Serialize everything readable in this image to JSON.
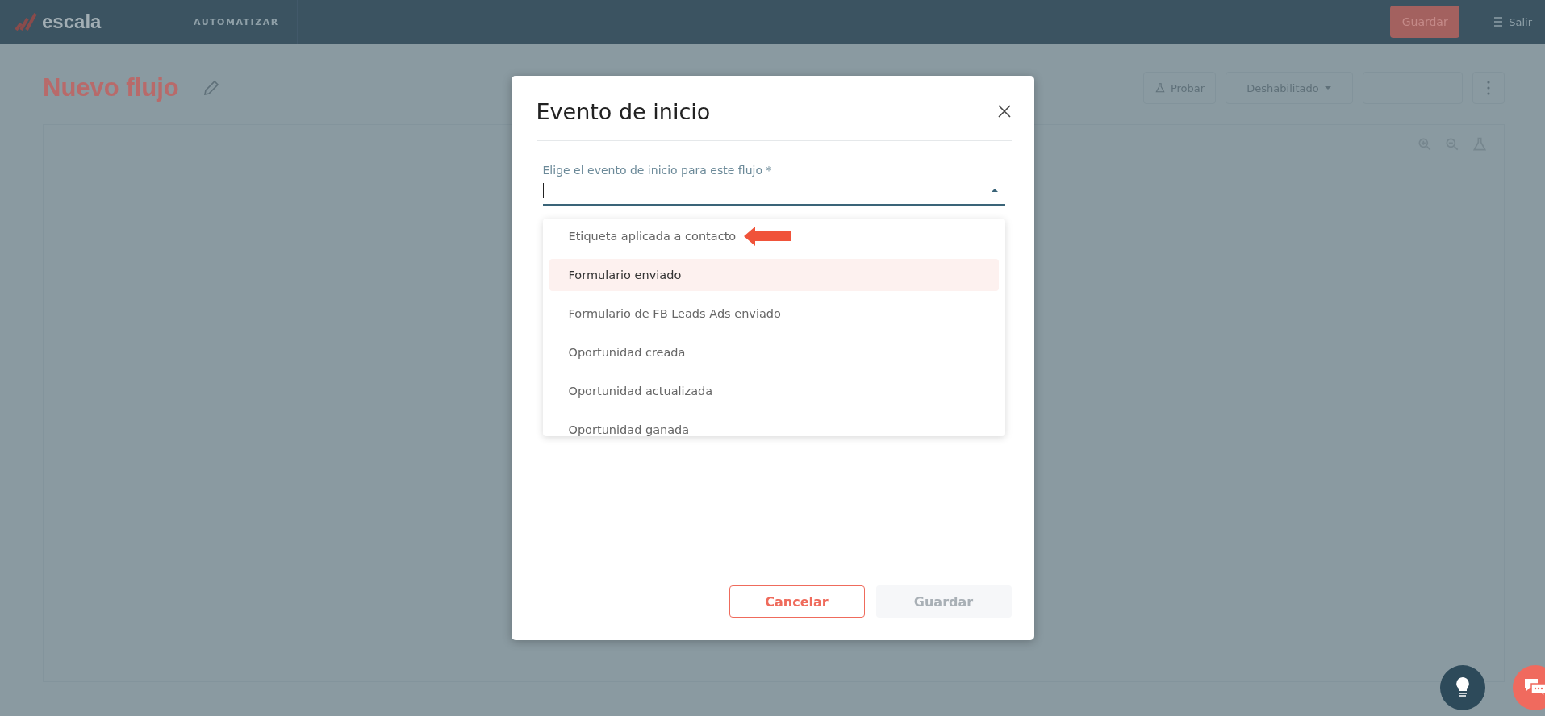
{
  "header": {
    "logo": "escala",
    "nav_items": [
      "AUTOMATIZAR"
    ],
    "save_button": "Guardar",
    "logout": "Salir"
  },
  "page": {
    "title": "Nuevo flujo",
    "test_button": "Probar",
    "status_select": "Deshabilitado"
  },
  "dialog": {
    "title": "Evento de inicio",
    "field": {
      "label": "Elige el evento de inicio para este flujo *",
      "expanded": true
    },
    "options": [
      {
        "label": "Etiqueta aplicada a contacto",
        "selected": false,
        "arrow": true
      },
      {
        "label": "Formulario enviado",
        "selected": true,
        "arrow": false
      },
      {
        "label": "Formulario de FB Leads Ads enviado",
        "selected": false,
        "arrow": false
      },
      {
        "label": "Oportunidad creada",
        "selected": false,
        "arrow": false
      },
      {
        "label": "Oportunidad actualizada",
        "selected": false,
        "arrow": false
      },
      {
        "label": "Oportunidad ganada",
        "selected": false,
        "arrow": false
      }
    ],
    "buttons": [
      {
        "label": "Cancelar",
        "kind": "outline",
        "disabled": false
      },
      {
        "label": "Guardar",
        "kind": "primary",
        "disabled": true
      }
    ]
  }
}
